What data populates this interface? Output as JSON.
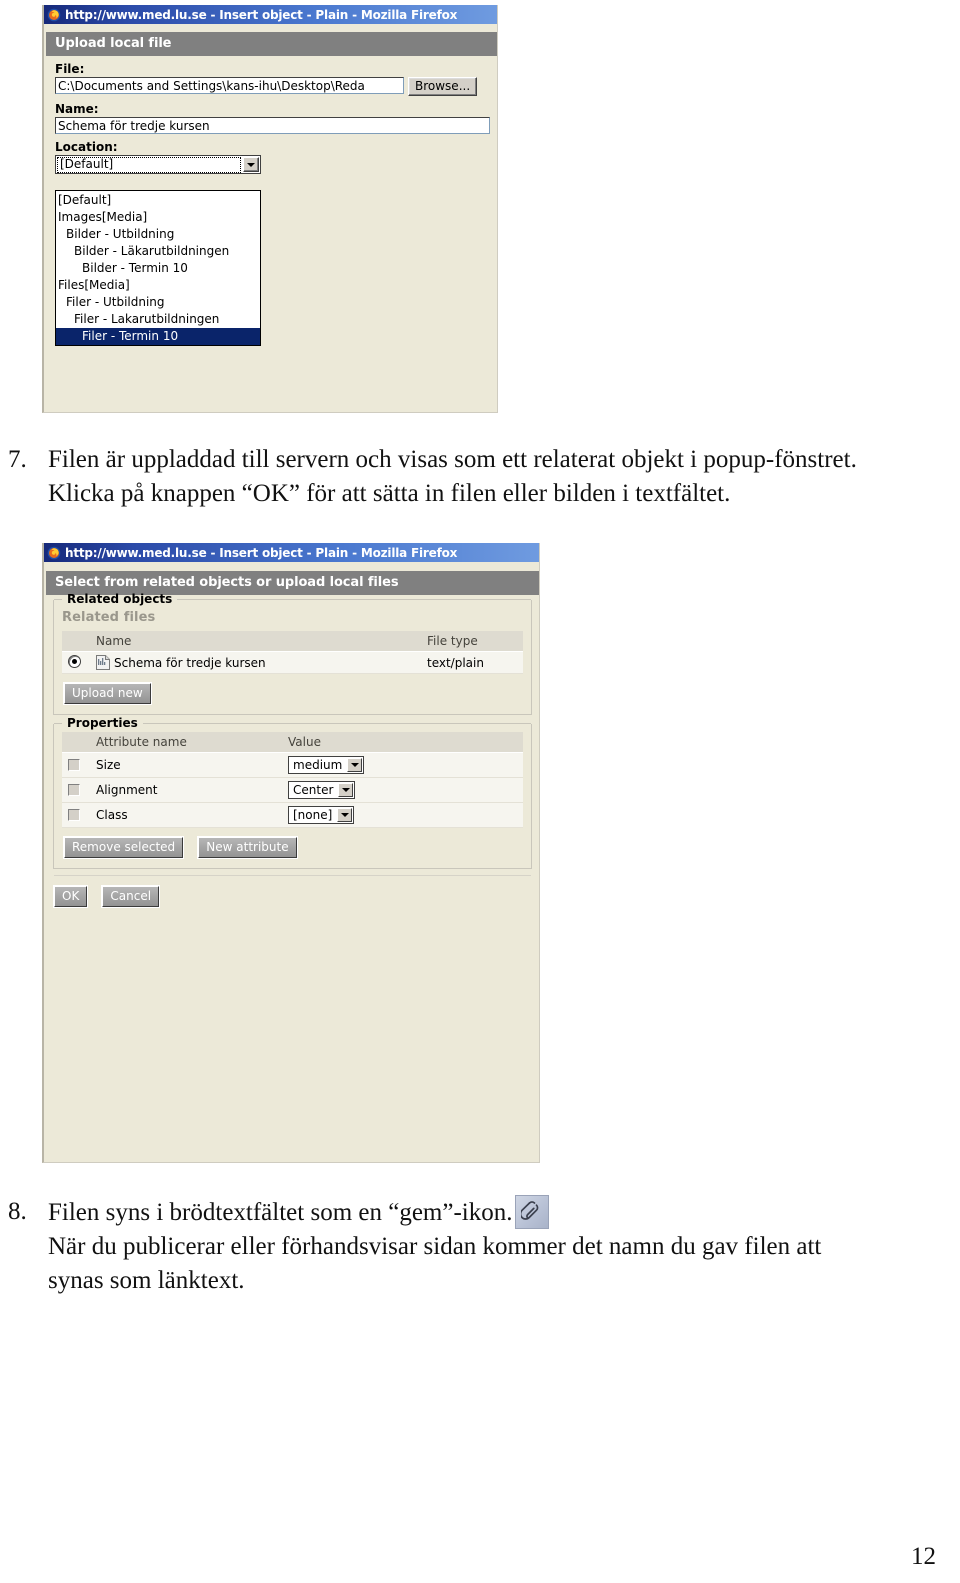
{
  "document": {
    "page_number": "12",
    "steps": [
      {
        "number": "7.",
        "line1": "Filen är uppladdad till servern och visas som ett relaterat objekt i popup-fönstret.",
        "line2": "Klicka på knappen “OK” för att sätta in filen eller bilden i textfältet."
      },
      {
        "number": "8.",
        "line1_before_icon": "Filen syns i brödtextfältet som en “gem”-ikon.",
        "icon": "paperclip-icon",
        "line2": "När du publicerar eller förhandsvisar sidan kommer det namn du gav filen att",
        "line3": "synas som länktext."
      }
    ]
  },
  "screenshot_upload": {
    "window_title": "http://www.med.lu.se - Insert object - Plain - Mozilla Firefox",
    "panel_heading": "Upload local file",
    "file_label": "File:",
    "file_value": "C:\\Documents and Settings\\kans-ihu\\Desktop\\Reda",
    "browse_button": "Browse...",
    "name_label": "Name:",
    "name_value": "Schema för tredje kursen",
    "location_label": "Location:",
    "location_selected": "[Default]",
    "location_options": [
      {
        "label": "[Default]",
        "indent": 0,
        "selected": false
      },
      {
        "label": "Images[Media]",
        "indent": 0,
        "selected": false
      },
      {
        "label": "Bilder - Utbildning",
        "indent": 1,
        "selected": false
      },
      {
        "label": "Bilder - Läkarutbildningen",
        "indent": 2,
        "selected": false
      },
      {
        "label": "Bilder - Termin 10",
        "indent": 3,
        "selected": false
      },
      {
        "label": "Files[Media]",
        "indent": 0,
        "selected": false
      },
      {
        "label": "Filer - Utbildning",
        "indent": 1,
        "selected": false
      },
      {
        "label": "Filer - Lakarutbildningen",
        "indent": 2,
        "selected": false
      },
      {
        "label": "Filer - Termin 10",
        "indent": 3,
        "selected": true
      }
    ]
  },
  "screenshot_insert": {
    "window_title": "http://www.med.lu.se - Insert object - Plain - Mozilla Firefox",
    "panel_heading": "Select from related objects or upload local files",
    "related_objects_legend": "Related objects",
    "related_files_subhead": "Related files",
    "files_table": {
      "headers": [
        "",
        "Name",
        "File type"
      ],
      "rows": [
        {
          "selected": true,
          "name": "Schema för tredje kursen",
          "file_type": "text/plain"
        }
      ]
    },
    "upload_new_button": "Upload new",
    "properties_legend": "Properties",
    "properties_table": {
      "headers": [
        "",
        "Attribute name",
        "Value"
      ],
      "rows": [
        {
          "checked": false,
          "attribute": "Size",
          "value": "medium"
        },
        {
          "checked": false,
          "attribute": "Alignment",
          "value": "Center"
        },
        {
          "checked": false,
          "attribute": "Class",
          "value": "[none]"
        }
      ]
    },
    "remove_selected_button": "Remove selected",
    "new_attribute_button": "New attribute",
    "ok_button": "OK",
    "cancel_button": "Cancel"
  },
  "colors": {
    "titlebar_blue": "#2b4aa8",
    "panel_heading_gray": "#808080",
    "window_face": "#ece9d8",
    "selection_blue": "#0a246a",
    "table_header": "#dedbd0"
  }
}
